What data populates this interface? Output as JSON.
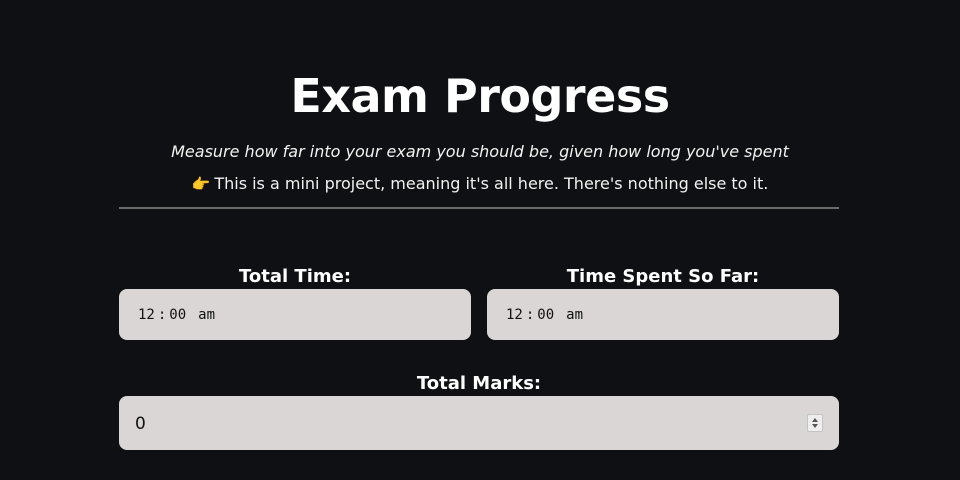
{
  "header": {
    "title": "Exam Progress",
    "subtitle": "Measure how far into your exam you should be, given how long you've spent",
    "note_icon": "backhand-index-pointing-right-emoji",
    "note_emoji": "👉",
    "note": "This is a mini project, meaning it's all here. There's nothing else to it."
  },
  "fields": {
    "total_time": {
      "label": "Total Time:",
      "hours": "12",
      "minutes": "00",
      "period": "am"
    },
    "time_spent": {
      "label": "Time Spent So Far:",
      "hours": "12",
      "minutes": "00",
      "period": "am"
    },
    "total_marks": {
      "label": "Total Marks:",
      "value": "0"
    }
  },
  "colors": {
    "background": "#0f1013",
    "input_background": "#dad6d5",
    "divider": "#6b6b6b",
    "text": "#ffffff"
  }
}
